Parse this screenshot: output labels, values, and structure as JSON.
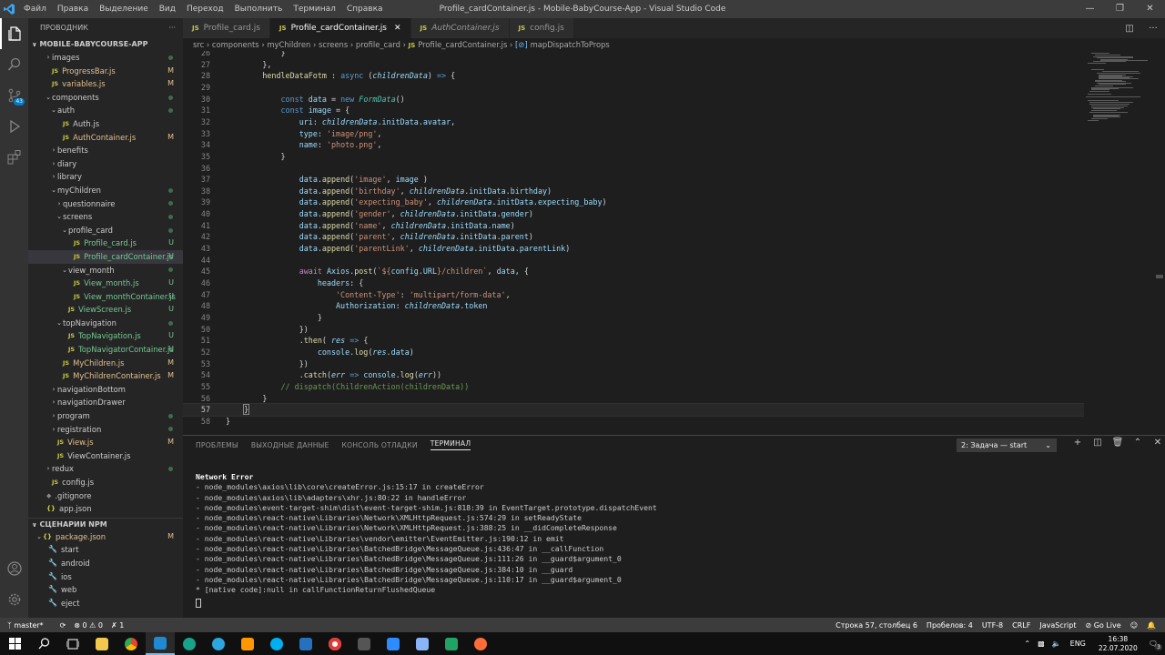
{
  "window": {
    "title": "Profile_cardContainer.js - Mobile-BabyCourse-App - Visual Studio Code",
    "menu": [
      "Файл",
      "Правка",
      "Выделение",
      "Вид",
      "Переход",
      "Выполнить",
      "Терминал",
      "Справка"
    ]
  },
  "activity_bar": {
    "items": [
      "explorer-icon",
      "search-icon",
      "source-control-icon",
      "run-icon",
      "extensions-icon"
    ],
    "scm_badge": "43"
  },
  "sidebar": {
    "header": "ПРОВОДНИК",
    "header_more": "···",
    "project": "MOBILE-BABYCOURSE-APP",
    "tree": [
      {
        "label": "images",
        "kind": "folder",
        "depth": 1,
        "status": "dot"
      },
      {
        "label": "ProgressBar.js",
        "kind": "js",
        "depth": 1,
        "status": "M"
      },
      {
        "label": "variables.js",
        "kind": "js",
        "depth": 1,
        "status": "M"
      },
      {
        "label": "components",
        "kind": "folder-open",
        "depth": 1,
        "status": "dot"
      },
      {
        "label": "auth",
        "kind": "folder-open",
        "depth": 2,
        "status": "dot"
      },
      {
        "label": "Auth.js",
        "kind": "js",
        "depth": 3,
        "status": ""
      },
      {
        "label": "AuthContainer.js",
        "kind": "js",
        "depth": 3,
        "status": "M"
      },
      {
        "label": "benefits",
        "kind": "folder",
        "depth": 2,
        "status": ""
      },
      {
        "label": "diary",
        "kind": "folder",
        "depth": 2,
        "status": ""
      },
      {
        "label": "library",
        "kind": "folder",
        "depth": 2,
        "status": ""
      },
      {
        "label": "myChildren",
        "kind": "folder-open",
        "depth": 2,
        "status": "dot"
      },
      {
        "label": "questionnaire",
        "kind": "folder",
        "depth": 3,
        "status": "dot"
      },
      {
        "label": "screens",
        "kind": "folder-open",
        "depth": 3,
        "status": "dot"
      },
      {
        "label": "profile_card",
        "kind": "folder-open",
        "depth": 4,
        "status": "dot"
      },
      {
        "label": "Profile_card.js",
        "kind": "js",
        "depth": 5,
        "status": "U"
      },
      {
        "label": "Profile_cardContainer.js",
        "kind": "js",
        "depth": 5,
        "status": "U",
        "selected": true
      },
      {
        "label": "view_month",
        "kind": "folder-open",
        "depth": 4,
        "status": "dot"
      },
      {
        "label": "View_month.js",
        "kind": "js",
        "depth": 5,
        "status": "U"
      },
      {
        "label": "View_monthContainer.js",
        "kind": "js",
        "depth": 5,
        "status": "U"
      },
      {
        "label": "ViewScreen.js",
        "kind": "js",
        "depth": 4,
        "status": "U"
      },
      {
        "label": "topNavigation",
        "kind": "folder-open",
        "depth": 3,
        "status": "dot"
      },
      {
        "label": "TopNavigation.js",
        "kind": "js",
        "depth": 4,
        "status": "U"
      },
      {
        "label": "TopNavigatorContainer.js",
        "kind": "js",
        "depth": 4,
        "status": "U"
      },
      {
        "label": "MyChildren.js",
        "kind": "js",
        "depth": 3,
        "status": "M"
      },
      {
        "label": "MyChildrenContainer.js",
        "kind": "js",
        "depth": 3,
        "status": "M"
      },
      {
        "label": "navigationBottom",
        "kind": "folder",
        "depth": 2,
        "status": ""
      },
      {
        "label": "navigationDrawer",
        "kind": "folder",
        "depth": 2,
        "status": ""
      },
      {
        "label": "program",
        "kind": "folder",
        "depth": 2,
        "status": "dot"
      },
      {
        "label": "registration",
        "kind": "folder",
        "depth": 2,
        "status": "dot"
      },
      {
        "label": "View.js",
        "kind": "js",
        "depth": 2,
        "status": "M"
      },
      {
        "label": "ViewContainer.js",
        "kind": "js",
        "depth": 2,
        "status": ""
      },
      {
        "label": "redux",
        "kind": "folder",
        "depth": 1,
        "status": "dot"
      },
      {
        "label": "config.js",
        "kind": "js",
        "depth": 1,
        "status": ""
      },
      {
        "label": ".gitignore",
        "kind": "git",
        "depth": 0,
        "status": ""
      },
      {
        "label": "app.json",
        "kind": "json",
        "depth": 0,
        "status": ""
      }
    ],
    "npm_section": "СЦЕНАРИИ NPM",
    "npm_tree": [
      {
        "label": "package.json",
        "kind": "json-open",
        "depth": 1,
        "status": "M"
      },
      {
        "label": "start",
        "kind": "script",
        "depth": 2,
        "status": ""
      },
      {
        "label": "android",
        "kind": "script",
        "depth": 2,
        "status": ""
      },
      {
        "label": "ios",
        "kind": "script",
        "depth": 2,
        "status": ""
      },
      {
        "label": "web",
        "kind": "script",
        "depth": 2,
        "status": ""
      },
      {
        "label": "eject",
        "kind": "script",
        "depth": 2,
        "status": ""
      }
    ]
  },
  "tabs": [
    {
      "label": "Profile_card.js",
      "active": false,
      "italic": false
    },
    {
      "label": "Profile_cardContainer.js",
      "active": true,
      "italic": false
    },
    {
      "label": "AuthContainer.js",
      "active": false,
      "italic": true
    },
    {
      "label": "config.js",
      "active": false,
      "italic": false
    }
  ],
  "breadcrumb": [
    "src",
    "components",
    "myChildren",
    "screens",
    "profile_card",
    "Profile_cardContainer.js",
    "mapDispatchToProps"
  ],
  "editor": {
    "current_line": "57",
    "lines": [
      {
        "n": "26",
        "html": "            <span class='p'>}</span>"
      },
      {
        "n": "27",
        "html": "        <span class='p'>},</span>"
      },
      {
        "n": "28",
        "html": "        <span class='f'>hendleDataFotm</span> <span class='p'>:</span> <span class='k'>async</span> <span class='p'>(</span><span class='pi'>childrenData</span><span class='p'>)</span> <span class='k'>=&gt;</span> <span class='p'>{</span>"
      },
      {
        "n": "29",
        "html": ""
      },
      {
        "n": "30",
        "html": "            <span class='k'>const</span> <span class='v'>data</span> <span class='p'>=</span> <span class='k'>new</span> <span class='ty' style='font-style:italic'>FormData</span><span class='p'>()</span>"
      },
      {
        "n": "31",
        "html": "            <span class='k'>const</span> <span class='v'>image</span> <span class='p'>= {</span>"
      },
      {
        "n": "32",
        "html": "                <span class='v'>uri</span><span class='p'>:</span> <span class='pi'>childrenData</span><span class='p'>.</span><span class='v'>initData</span><span class='p'>.</span><span class='v'>avatar</span><span class='p'>,</span>"
      },
      {
        "n": "33",
        "html": "                <span class='v'>type</span><span class='p'>:</span> <span class='s'>'image/png'</span><span class='p'>,</span>"
      },
      {
        "n": "34",
        "html": "                <span class='v'>name</span><span class='p'>:</span> <span class='s'>'photo.png'</span><span class='p'>,</span>"
      },
      {
        "n": "35",
        "html": "            <span class='p'>}</span>"
      },
      {
        "n": "36",
        "html": ""
      },
      {
        "n": "37",
        "html": "                <span class='v'>data</span><span class='p'>.</span><span class='f'>append</span><span class='p'>(</span><span class='s'>'image'</span><span class='p'>,</span> <span class='v'>image</span> <span class='p'>)</span>"
      },
      {
        "n": "38",
        "html": "                <span class='v'>data</span><span class='p'>.</span><span class='f'>append</span><span class='p'>(</span><span class='s'>'birthday'</span><span class='p'>,</span> <span class='pi'>childrenData</span><span class='p'>.</span><span class='v'>initData</span><span class='p'>.</span><span class='v'>birthday</span><span class='p'>)</span>"
      },
      {
        "n": "39",
        "html": "                <span class='v'>data</span><span class='p'>.</span><span class='f'>append</span><span class='p'>(</span><span class='s'>'expecting_baby'</span><span class='p'>,</span> <span class='pi'>childrenData</span><span class='p'>.</span><span class='v'>initData</span><span class='p'>.</span><span class='v'>expecting_baby</span><span class='p'>)</span>"
      },
      {
        "n": "40",
        "html": "                <span class='v'>data</span><span class='p'>.</span><span class='f'>append</span><span class='p'>(</span><span class='s'>'gender'</span><span class='p'>,</span> <span class='pi'>childrenData</span><span class='p'>.</span><span class='v'>initData</span><span class='p'>.</span><span class='v'>gender</span><span class='p'>)</span>"
      },
      {
        "n": "41",
        "html": "                <span class='v'>data</span><span class='p'>.</span><span class='f'>append</span><span class='p'>(</span><span class='s'>'name'</span><span class='p'>,</span> <span class='pi'>childrenData</span><span class='p'>.</span><span class='v'>initData</span><span class='p'>.</span><span class='v'>name</span><span class='p'>)</span>"
      },
      {
        "n": "42",
        "html": "                <span class='v'>data</span><span class='p'>.</span><span class='f'>append</span><span class='p'>(</span><span class='s'>'parent'</span><span class='p'>,</span> <span class='pi'>childrenData</span><span class='p'>.</span><span class='v'>initData</span><span class='p'>.</span><span class='v'>parent</span><span class='p'>)</span>"
      },
      {
        "n": "43",
        "html": "                <span class='v'>data</span><span class='p'>.</span><span class='f'>append</span><span class='p'>(</span><span class='s'>'parentLink'</span><span class='p'>,</span> <span class='pi'>childrenData</span><span class='p'>.</span><span class='v'>initData</span><span class='p'>.</span><span class='v'>parentLink</span><span class='p'>)</span>"
      },
      {
        "n": "44",
        "html": ""
      },
      {
        "n": "45",
        "html": "                <span class='kc'>await</span> <span class='v'>Axios</span><span class='p'>.</span><span class='f'>post</span><span class='p'>(</span><span class='s'>`${</span><span class='v'>config</span><span class='p'>.</span><span class='v'>URL</span><span class='s'>}/children`</span><span class='p'>,</span> <span class='v'>data</span><span class='p'>, {</span>"
      },
      {
        "n": "46",
        "html": "                    <span class='v'>headers</span><span class='p'>: {</span>"
      },
      {
        "n": "47",
        "html": "                        <span class='s'>'Content-Type'</span><span class='p'>:</span> <span class='s'>'multipart/form-data'</span><span class='p'>,</span>"
      },
      {
        "n": "48",
        "html": "                        <span class='v'>Authorization</span><span class='p'>:</span> <span class='pi'>childrenData</span><span class='p'>.</span><span class='v'>token</span>"
      },
      {
        "n": "49",
        "html": "                    <span class='p'>}</span>"
      },
      {
        "n": "50",
        "html": "                <span class='p'>})</span>"
      },
      {
        "n": "51",
        "html": "                <span class='p'>.</span><span class='f'>then</span><span class='p'>(</span> <span class='pi'>res</span> <span class='k'>=&gt;</span> <span class='p'>{</span>"
      },
      {
        "n": "52",
        "html": "                    <span class='v'>console</span><span class='p'>.</span><span class='f'>log</span><span class='p'>(</span><span class='pi'>res</span><span class='p'>.</span><span class='v'>data</span><span class='p'>)</span>"
      },
      {
        "n": "53",
        "html": "                <span class='p'>})</span>"
      },
      {
        "n": "54",
        "html": "                <span class='p'>.</span><span class='f'>catch</span><span class='p'>(</span><span class='pi'>err</span> <span class='k'>=&gt;</span> <span class='v'>console</span><span class='p'>.</span><span class='f'>log</span><span class='p'>(</span><span class='pi'>err</span><span class='p'>))</span>"
      },
      {
        "n": "55",
        "html": "            <span class='cm'>// dispatch(ChildrenAction(childrenData))</span>"
      },
      {
        "n": "56",
        "html": "        <span class='p'>}</span>"
      },
      {
        "n": "57",
        "html": "    <span class='p' style='outline:1px solid #888'>}</span>"
      },
      {
        "n": "58",
        "html": "<span class='p'>}</span>"
      }
    ]
  },
  "panel": {
    "tabs": [
      "ПРОБЛЕМЫ",
      "ВЫХОДНЫЕ ДАННЫЕ",
      "КОНСОЛЬ ОТЛАДКИ",
      "ТЕРМИНАЛ"
    ],
    "active_tab": "ТЕРМИНАЛ",
    "terminal_select": "2: Задача — start",
    "terminal_lines": [
      "Network Error",
      "- node_modules\\axios\\lib\\core\\createError.js:15:17 in createError",
      "- node_modules\\axios\\lib\\adapters\\xhr.js:80:22 in handleError",
      "- node_modules\\event-target-shim\\dist\\event-target-shim.js:818:39 in EventTarget.prototype.dispatchEvent",
      "- node_modules\\react-native\\Libraries\\Network\\XMLHttpRequest.js:574:29 in setReadyState",
      "- node_modules\\react-native\\Libraries\\Network\\XMLHttpRequest.js:388:25 in __didCompleteResponse",
      "- node_modules\\react-native\\Libraries\\vendor\\emitter\\EventEmitter.js:190:12 in emit",
      "- node_modules\\react-native\\Libraries\\BatchedBridge\\MessageQueue.js:436:47 in __callFunction",
      "- node_modules\\react-native\\Libraries\\BatchedBridge\\MessageQueue.js:111:26 in __guard$argument_0",
      "- node_modules\\react-native\\Libraries\\BatchedBridge\\MessageQueue.js:384:10 in __guard",
      "- node_modules\\react-native\\Libraries\\BatchedBridge\\MessageQueue.js:110:17 in __guard$argument_0",
      "* [native code]:null in callFunctionReturnFlushedQueue"
    ]
  },
  "statusbar": {
    "branch": "master*",
    "sync": "⟳",
    "problems": "⊗ 0 ⚠ 0",
    "ports": "✗ 1",
    "position": "Строка 57, столбец 6",
    "spaces": "Пробелов: 4",
    "encoding": "UTF-8",
    "eol": "CRLF",
    "language": "JavaScript",
    "live": "⊘ Go Live"
  },
  "taskbar": {
    "lang": "ENG",
    "time": "16:38",
    "date": "22.07.2020",
    "notifications": "3"
  },
  "colors": {
    "accent": "#007acc",
    "modified": "#e2c08d",
    "untracked": "#73c991"
  }
}
